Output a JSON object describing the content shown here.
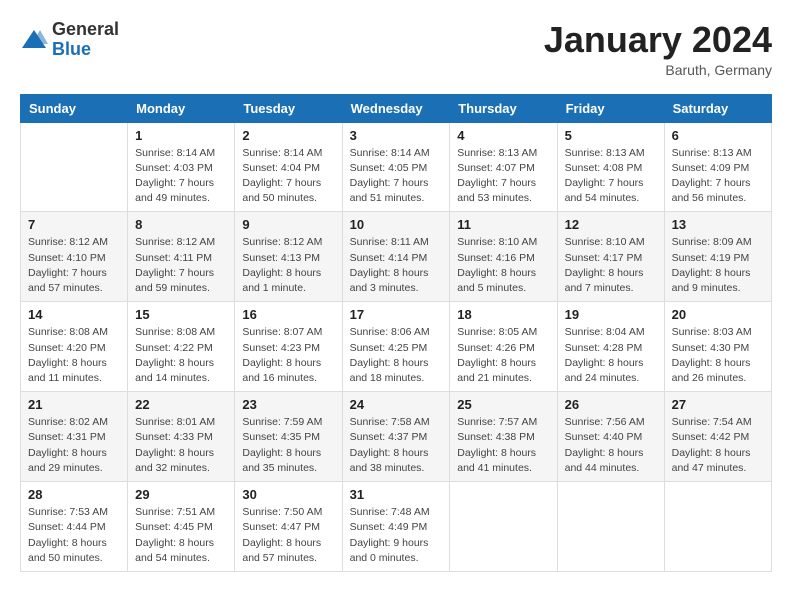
{
  "header": {
    "logo_general": "General",
    "logo_blue": "Blue",
    "month_title": "January 2024",
    "subtitle": "Baruth, Germany"
  },
  "days_of_week": [
    "Sunday",
    "Monday",
    "Tuesday",
    "Wednesday",
    "Thursday",
    "Friday",
    "Saturday"
  ],
  "weeks": [
    [
      {
        "day": "",
        "sunrise": "",
        "sunset": "",
        "daylight": ""
      },
      {
        "day": "1",
        "sunrise": "Sunrise: 8:14 AM",
        "sunset": "Sunset: 4:03 PM",
        "daylight": "Daylight: 7 hours and 49 minutes."
      },
      {
        "day": "2",
        "sunrise": "Sunrise: 8:14 AM",
        "sunset": "Sunset: 4:04 PM",
        "daylight": "Daylight: 7 hours and 50 minutes."
      },
      {
        "day": "3",
        "sunrise": "Sunrise: 8:14 AM",
        "sunset": "Sunset: 4:05 PM",
        "daylight": "Daylight: 7 hours and 51 minutes."
      },
      {
        "day": "4",
        "sunrise": "Sunrise: 8:13 AM",
        "sunset": "Sunset: 4:07 PM",
        "daylight": "Daylight: 7 hours and 53 minutes."
      },
      {
        "day": "5",
        "sunrise": "Sunrise: 8:13 AM",
        "sunset": "Sunset: 4:08 PM",
        "daylight": "Daylight: 7 hours and 54 minutes."
      },
      {
        "day": "6",
        "sunrise": "Sunrise: 8:13 AM",
        "sunset": "Sunset: 4:09 PM",
        "daylight": "Daylight: 7 hours and 56 minutes."
      }
    ],
    [
      {
        "day": "7",
        "sunrise": "Sunrise: 8:12 AM",
        "sunset": "Sunset: 4:10 PM",
        "daylight": "Daylight: 7 hours and 57 minutes."
      },
      {
        "day": "8",
        "sunrise": "Sunrise: 8:12 AM",
        "sunset": "Sunset: 4:11 PM",
        "daylight": "Daylight: 7 hours and 59 minutes."
      },
      {
        "day": "9",
        "sunrise": "Sunrise: 8:12 AM",
        "sunset": "Sunset: 4:13 PM",
        "daylight": "Daylight: 8 hours and 1 minute."
      },
      {
        "day": "10",
        "sunrise": "Sunrise: 8:11 AM",
        "sunset": "Sunset: 4:14 PM",
        "daylight": "Daylight: 8 hours and 3 minutes."
      },
      {
        "day": "11",
        "sunrise": "Sunrise: 8:10 AM",
        "sunset": "Sunset: 4:16 PM",
        "daylight": "Daylight: 8 hours and 5 minutes."
      },
      {
        "day": "12",
        "sunrise": "Sunrise: 8:10 AM",
        "sunset": "Sunset: 4:17 PM",
        "daylight": "Daylight: 8 hours and 7 minutes."
      },
      {
        "day": "13",
        "sunrise": "Sunrise: 8:09 AM",
        "sunset": "Sunset: 4:19 PM",
        "daylight": "Daylight: 8 hours and 9 minutes."
      }
    ],
    [
      {
        "day": "14",
        "sunrise": "Sunrise: 8:08 AM",
        "sunset": "Sunset: 4:20 PM",
        "daylight": "Daylight: 8 hours and 11 minutes."
      },
      {
        "day": "15",
        "sunrise": "Sunrise: 8:08 AM",
        "sunset": "Sunset: 4:22 PM",
        "daylight": "Daylight: 8 hours and 14 minutes."
      },
      {
        "day": "16",
        "sunrise": "Sunrise: 8:07 AM",
        "sunset": "Sunset: 4:23 PM",
        "daylight": "Daylight: 8 hours and 16 minutes."
      },
      {
        "day": "17",
        "sunrise": "Sunrise: 8:06 AM",
        "sunset": "Sunset: 4:25 PM",
        "daylight": "Daylight: 8 hours and 18 minutes."
      },
      {
        "day": "18",
        "sunrise": "Sunrise: 8:05 AM",
        "sunset": "Sunset: 4:26 PM",
        "daylight": "Daylight: 8 hours and 21 minutes."
      },
      {
        "day": "19",
        "sunrise": "Sunrise: 8:04 AM",
        "sunset": "Sunset: 4:28 PM",
        "daylight": "Daylight: 8 hours and 24 minutes."
      },
      {
        "day": "20",
        "sunrise": "Sunrise: 8:03 AM",
        "sunset": "Sunset: 4:30 PM",
        "daylight": "Daylight: 8 hours and 26 minutes."
      }
    ],
    [
      {
        "day": "21",
        "sunrise": "Sunrise: 8:02 AM",
        "sunset": "Sunset: 4:31 PM",
        "daylight": "Daylight: 8 hours and 29 minutes."
      },
      {
        "day": "22",
        "sunrise": "Sunrise: 8:01 AM",
        "sunset": "Sunset: 4:33 PM",
        "daylight": "Daylight: 8 hours and 32 minutes."
      },
      {
        "day": "23",
        "sunrise": "Sunrise: 7:59 AM",
        "sunset": "Sunset: 4:35 PM",
        "daylight": "Daylight: 8 hours and 35 minutes."
      },
      {
        "day": "24",
        "sunrise": "Sunrise: 7:58 AM",
        "sunset": "Sunset: 4:37 PM",
        "daylight": "Daylight: 8 hours and 38 minutes."
      },
      {
        "day": "25",
        "sunrise": "Sunrise: 7:57 AM",
        "sunset": "Sunset: 4:38 PM",
        "daylight": "Daylight: 8 hours and 41 minutes."
      },
      {
        "day": "26",
        "sunrise": "Sunrise: 7:56 AM",
        "sunset": "Sunset: 4:40 PM",
        "daylight": "Daylight: 8 hours and 44 minutes."
      },
      {
        "day": "27",
        "sunrise": "Sunrise: 7:54 AM",
        "sunset": "Sunset: 4:42 PM",
        "daylight": "Daylight: 8 hours and 47 minutes."
      }
    ],
    [
      {
        "day": "28",
        "sunrise": "Sunrise: 7:53 AM",
        "sunset": "Sunset: 4:44 PM",
        "daylight": "Daylight: 8 hours and 50 minutes."
      },
      {
        "day": "29",
        "sunrise": "Sunrise: 7:51 AM",
        "sunset": "Sunset: 4:45 PM",
        "daylight": "Daylight: 8 hours and 54 minutes."
      },
      {
        "day": "30",
        "sunrise": "Sunrise: 7:50 AM",
        "sunset": "Sunset: 4:47 PM",
        "daylight": "Daylight: 8 hours and 57 minutes."
      },
      {
        "day": "31",
        "sunrise": "Sunrise: 7:48 AM",
        "sunset": "Sunset: 4:49 PM",
        "daylight": "Daylight: 9 hours and 0 minutes."
      },
      {
        "day": "",
        "sunrise": "",
        "sunset": "",
        "daylight": ""
      },
      {
        "day": "",
        "sunrise": "",
        "sunset": "",
        "daylight": ""
      },
      {
        "day": "",
        "sunrise": "",
        "sunset": "",
        "daylight": ""
      }
    ]
  ]
}
